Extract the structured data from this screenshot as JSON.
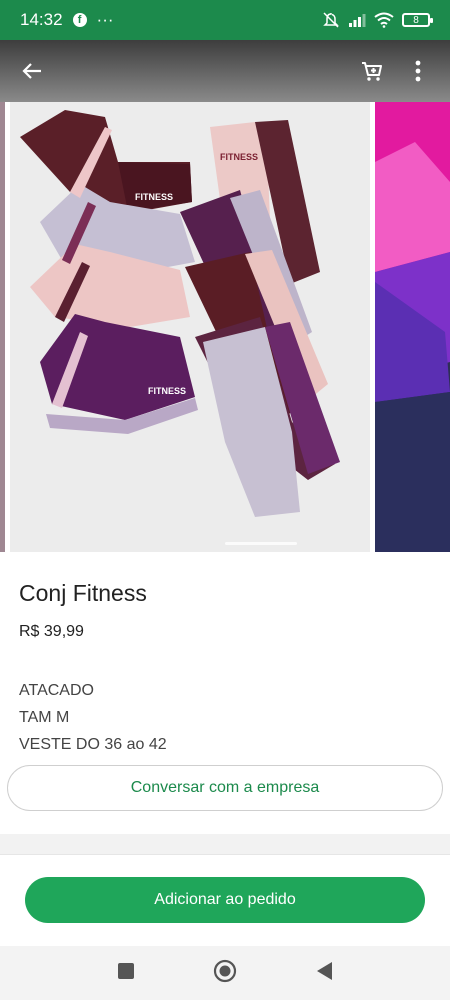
{
  "status_bar": {
    "time": "14:32",
    "facebook_glyph": "f",
    "more_indicator": "···",
    "battery_level": "8"
  },
  "app_bar": {
    "icons": [
      "back-arrow-icon",
      "cart-icon",
      "more-vert-icon"
    ]
  },
  "gallery": {
    "active_index": 1,
    "images": [
      "previous-product-image",
      "main-product-image",
      "next-product-image"
    ],
    "print_text": "FITNESS"
  },
  "product": {
    "title": "Conj Fitness",
    "price": "R$ 39,99",
    "description": [
      "ATACADO",
      "TAM M",
      "VESTE DO 36 ao 42"
    ]
  },
  "actions": {
    "chat_label": "Conversar com a empresa",
    "add_label": "Adicionar ao pedido"
  },
  "nav_bar": {
    "icons": [
      "recent-apps-icon",
      "home-icon",
      "back-icon"
    ]
  },
  "colors": {
    "brand_green": "#1c8a4c",
    "button_green": "#1fa65a"
  }
}
